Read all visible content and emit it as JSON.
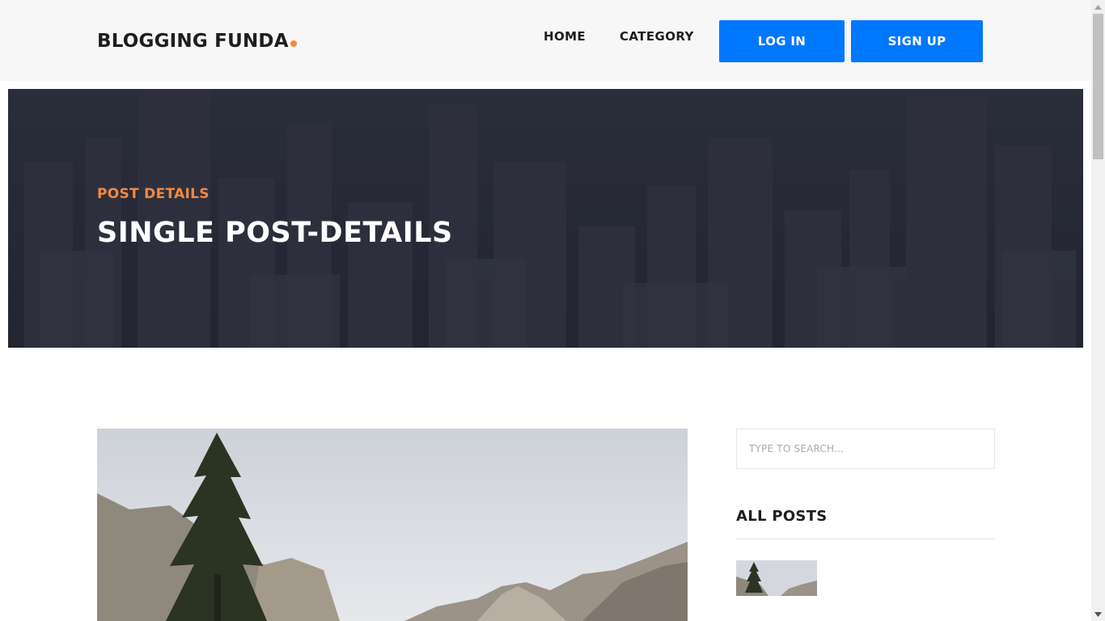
{
  "header": {
    "logo": "BLOGGING FUNDA",
    "nav": [
      "HOME",
      "CATEGORY"
    ],
    "login_label": "LOG IN",
    "signup_label": "SIGN UP"
  },
  "hero": {
    "kicker": "POST DETAILS",
    "title": "SINGLE POST-DETAILS"
  },
  "sidebar": {
    "search_placeholder": "TYPE TO SEARCH...",
    "heading": "ALL POSTS"
  },
  "colors": {
    "accent": "#f48840",
    "button": "#0077ff",
    "text_dark": "#1e1e1e"
  }
}
